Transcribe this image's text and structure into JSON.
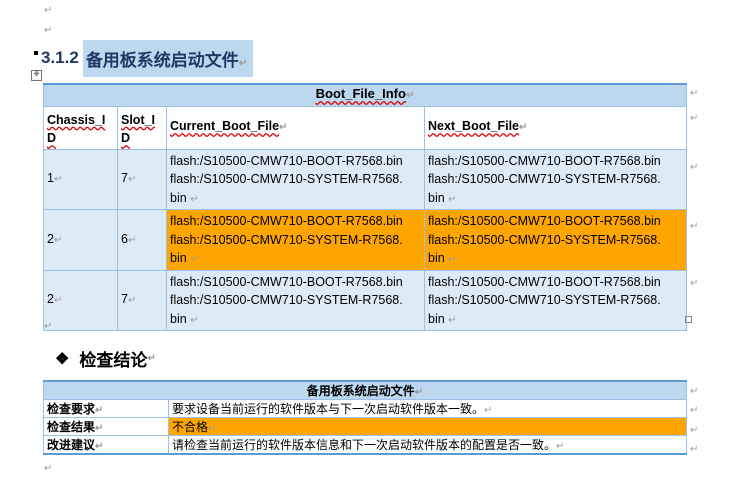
{
  "section": {
    "number": "3.1.2",
    "title": "备用板系统启动文件"
  },
  "boot_table": {
    "caption": "Boot_File_Info",
    "headers": [
      "Chassis_ID",
      "Slot_ID",
      "Current_Boot_File",
      "Next_Boot_File"
    ],
    "rows": [
      {
        "chassis": "1",
        "slot": "7",
        "current": [
          "flash:/S10500-CMW710-BOOT-R7568.bin",
          "flash:/S10500-CMW710-SYSTEM-R7568.",
          "bin"
        ],
        "next": [
          "flash:/S10500-CMW710-BOOT-R7568.bin",
          "flash:/S10500-CMW710-SYSTEM-R7568.",
          "bin"
        ]
      },
      {
        "chassis": "2",
        "slot": "6",
        "current": [
          "flash:/S10500-CMW710-BOOT-R7568.bin",
          "flash:/S10500-CMW710-SYSTEM-R7568.",
          "bin"
        ],
        "next": [
          "flash:/S10500-CMW710-BOOT-R7568.bin",
          "flash:/S10500-CMW710-SYSTEM-R7568.",
          "bin"
        ]
      },
      {
        "chassis": "2",
        "slot": "7",
        "current": [
          "flash:/S10500-CMW710-BOOT-R7568.bin",
          "flash:/S10500-CMW710-SYSTEM-R7568.",
          "bin"
        ],
        "next": [
          "flash:/S10500-CMW710-BOOT-R7568.bin",
          "flash:/S10500-CMW710-SYSTEM-R7568.",
          "bin"
        ]
      }
    ],
    "highlight_color": "#ffa500"
  },
  "conclusion": {
    "heading": "检查结论",
    "caption": "备用板系统启动文件",
    "rows": [
      {
        "label": "检查要求",
        "value": "要求设备当前运行的软件版本与下一次启动软件版本一致。"
      },
      {
        "label": "检查结果",
        "value": "不合格"
      },
      {
        "label": "改进建议",
        "value": "请检查当前运行的软件版本信息和下一次启动软件版本的配置是否一致。"
      }
    ]
  },
  "marks": {
    "paragraph": "↵"
  }
}
